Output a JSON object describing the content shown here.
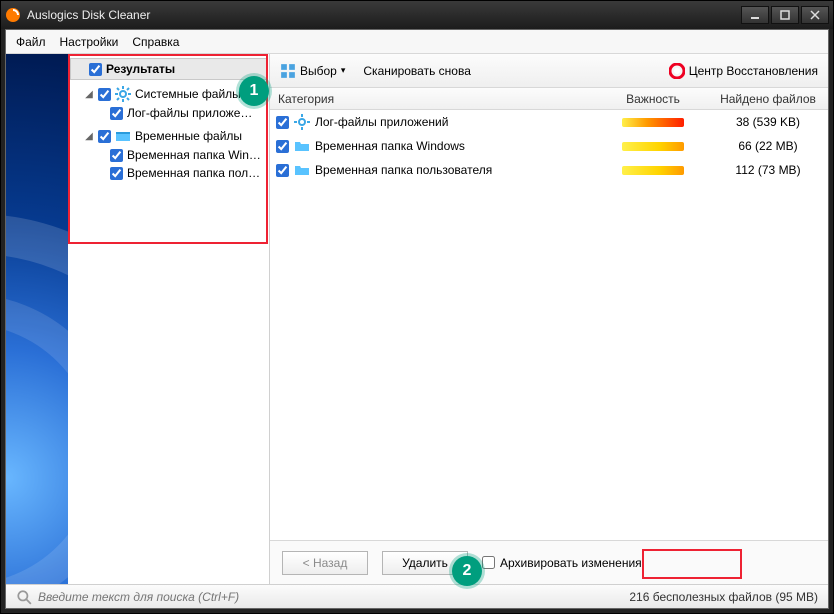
{
  "window": {
    "title": "Auslogics Disk Cleaner"
  },
  "menu": {
    "file": "Файл",
    "settings": "Настройки",
    "help": "Справка"
  },
  "tree": {
    "root": "Результаты",
    "g1": {
      "label": "Системные файлы",
      "c1": "Лог-файлы приложе…"
    },
    "g2": {
      "label": "Временные файлы",
      "c1": "Временная папка Win…",
      "c2": "Временная папка пол…"
    }
  },
  "toolbar": {
    "select": "Выбор",
    "rescan": "Сканировать снова",
    "recovery": "Центр Восстановления"
  },
  "grid": {
    "head": {
      "category": "Категория",
      "importance": "Важность",
      "found": "Найдено файлов"
    },
    "rows": [
      {
        "label": "Лог-файлы приложений",
        "imp": "imp-high",
        "found": "38 (539 KB)",
        "icon": "gear"
      },
      {
        "label": "Временная папка Windows",
        "imp": "imp-med",
        "found": "66 (22 MB)",
        "icon": "folder"
      },
      {
        "label": "Временная папка пользователя",
        "imp": "imp-med",
        "found": "112 (73 MB)",
        "icon": "folder"
      }
    ]
  },
  "actions": {
    "back": "< Назад",
    "delete": "Удалить",
    "archive": "Архивировать изменения"
  },
  "status": {
    "search_placeholder": "Введите текст для поиска (Ctrl+F)",
    "summary": "216 бесполезных файлов (95 MB)"
  },
  "callout": {
    "one": "1",
    "two": "2"
  }
}
